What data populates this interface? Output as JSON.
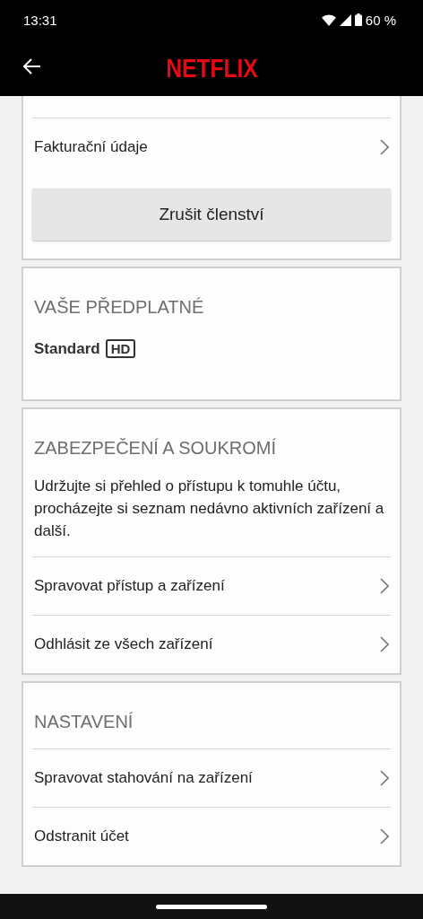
{
  "status_bar": {
    "time": "13:31",
    "battery": "60 %"
  },
  "header": {
    "logo": "NETFLIX"
  },
  "membership": {
    "rows": [
      {
        "label": "Fakturační údaje"
      }
    ],
    "cancel_button": "Zrušit členství"
  },
  "plan": {
    "title": "VAŠE PŘEDPLATNÉ",
    "name": "Standard",
    "badge": "HD"
  },
  "security": {
    "title": "ZABEZPEČENÍ A SOUKROMÍ",
    "description": "Udržujte si přehled o přístupu k tomuhle účtu, procházejte si seznam nedávno aktivních zařízení a další.",
    "rows": [
      {
        "label": "Spravovat přístup a zařízení"
      },
      {
        "label": "Odhlásit ze všech zařízení"
      }
    ]
  },
  "settings": {
    "title": "NASTAVENÍ",
    "rows": [
      {
        "label": "Spravovat stahování na zařízení"
      },
      {
        "label": "Odstranit účet"
      }
    ]
  }
}
